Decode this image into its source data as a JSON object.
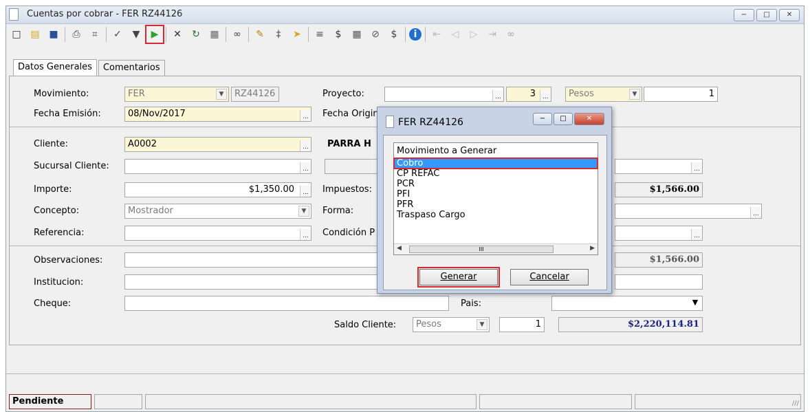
{
  "window": {
    "title": "Cuentas por cobrar - FER RZ44126",
    "min_label": "−",
    "max_label": "□",
    "close_label": "✕"
  },
  "toolbar": {
    "icons": [
      {
        "name": "new-doc-icon",
        "glyph": "□",
        "color": "#333"
      },
      {
        "name": "open-folder-icon",
        "glyph": "▤",
        "color": "#d9a520"
      },
      {
        "name": "save-icon",
        "glyph": "■",
        "color": "#2a4f9e"
      },
      {
        "name": "print-icon",
        "glyph": "⎙",
        "color": "#444"
      },
      {
        "name": "preview-icon",
        "glyph": "⌗",
        "color": "#444"
      },
      {
        "name": "spellcheck-icon",
        "glyph": "✓",
        "color": "#444"
      },
      {
        "name": "filter-icon",
        "glyph": "▼",
        "color": "#444"
      },
      {
        "name": "play-affect-icon",
        "glyph": "▶",
        "color": "#2ea12e",
        "highlight": true
      },
      {
        "name": "cancel-icon",
        "glyph": "✕",
        "color": "#333"
      },
      {
        "name": "refresh-icon",
        "glyph": "↻",
        "color": "#2c6e2c"
      },
      {
        "name": "cfdi-icon",
        "glyph": "▦",
        "color": "#666"
      },
      {
        "name": "link-icon",
        "glyph": "∞",
        "color": "#444"
      },
      {
        "name": "edit-icon",
        "glyph": "✎",
        "color": "#b8860b"
      },
      {
        "name": "attach-icon",
        "glyph": "‡",
        "color": "#555"
      },
      {
        "name": "forward-icon",
        "glyph": "➤",
        "color": "#d9a520"
      },
      {
        "name": "report-icon",
        "glyph": "≡",
        "color": "#555"
      },
      {
        "name": "dollar-icon",
        "glyph": "$",
        "color": "#333"
      },
      {
        "name": "calculator-icon",
        "glyph": "▦",
        "color": "#555"
      },
      {
        "name": "tag-icon",
        "glyph": "⊘",
        "color": "#555"
      },
      {
        "name": "payment-icon",
        "glyph": "$",
        "color": "#444"
      },
      {
        "name": "info-icon",
        "glyph": "i",
        "color": "#fff",
        "bg": "#1f6fd1"
      },
      {
        "name": "first-record-icon",
        "glyph": "⇤",
        "color": "#bbb"
      },
      {
        "name": "prev-record-icon",
        "glyph": "◁",
        "color": "#bbb"
      },
      {
        "name": "next-record-icon",
        "glyph": "▷",
        "color": "#bbb"
      },
      {
        "name": "last-record-icon",
        "glyph": "⇥",
        "color": "#bbb"
      },
      {
        "name": "users-icon",
        "glyph": "∞",
        "color": "#aaa"
      }
    ]
  },
  "tabs": [
    "Datos Generales",
    "Comentarios"
  ],
  "form": {
    "movimiento_label": "Movimiento:",
    "movimiento": "FER",
    "movid": "RZ44126",
    "proyecto_label": "Proyecto:",
    "proyecto": "",
    "proyecto_num": "3",
    "moneda": "Pesos",
    "tipo_cambio": "1",
    "fecha_emision_label": "Fecha Emisión:",
    "fecha_emision": "08/Nov/2017",
    "fecha_original_label": "Fecha Original:",
    "cliente_label": "Cliente:",
    "cliente": "A0002",
    "cliente_nombre": "PARRA H",
    "sucursal_label": "Sucursal Cliente:",
    "importe_label": "Importe:",
    "importe": "$1,350.00",
    "impuestos_label": "Impuestos:",
    "total": "$1,566.00",
    "concepto_label": "Concepto:",
    "concepto": "Mostrador",
    "forma_label": "Forma:",
    "referencia_label": "Referencia:",
    "condicion_label": "Condición P",
    "observaciones_label": "Observaciones:",
    "saldo": "$1,566.00",
    "institucion_label": "Institucion:",
    "cheque_label": "Cheque:",
    "pais_label": "Pais:",
    "saldo_cliente_label": "Saldo Cliente:",
    "saldo_moneda": "Pesos",
    "saldo_tc": "1",
    "saldo_cliente": "$2,220,114.81"
  },
  "status": {
    "state": "Pendiente"
  },
  "dialog": {
    "title": "FER RZ44126",
    "list_header": "Movimiento a Generar",
    "items": [
      "Cobro",
      "CP REFAC",
      "PCR",
      "PFI",
      "PFR",
      "Traspaso Cargo"
    ],
    "selected": 0,
    "generar": "Generar",
    "cancelar": "Cancelar",
    "scroll_thumb": "III"
  },
  "colors": {
    "highlight": "#d7282f",
    "selection": "#3399ff",
    "money": "#1a237e",
    "input_yellow": "#fbf6d6"
  }
}
